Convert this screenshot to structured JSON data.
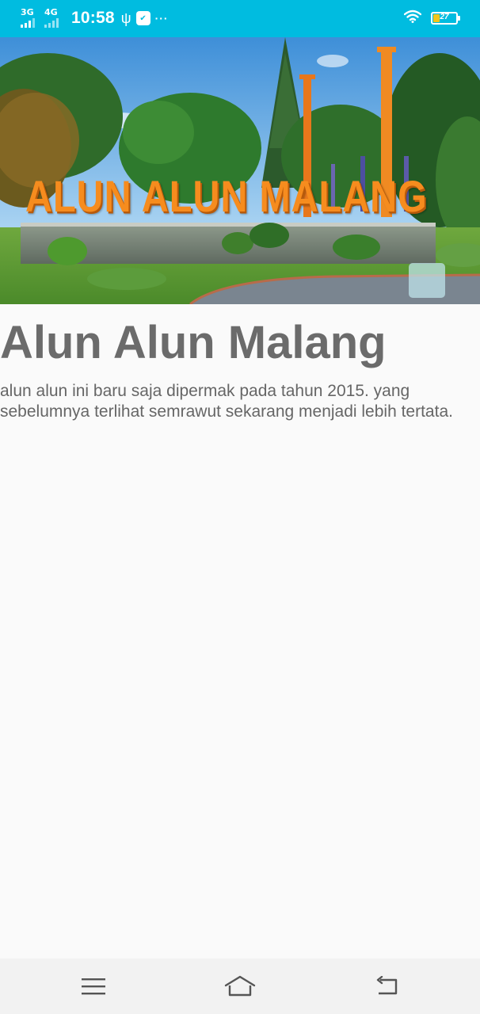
{
  "status_bar": {
    "network_1": "3G",
    "network_2": "4G",
    "time": "10:58",
    "battery_level": "27",
    "background_color": "#00bce0",
    "icons": [
      "signal-icon",
      "usb-icon",
      "app-notification-icon",
      "more-icon",
      "wifi-icon",
      "battery-icon"
    ]
  },
  "hero": {
    "sign_text": "ALUN ALUN MALANG",
    "image_subject": "park-landmark-photo"
  },
  "article": {
    "title": "Alun Alun Malang",
    "description": "alun alun ini baru saja dipermak pada tahun 2015. yang sebelumnya terlihat semrawut sekarang menjadi lebih tertata."
  },
  "nav_bar": {
    "icons": [
      "menu-icon",
      "home-icon",
      "back-icon"
    ]
  }
}
